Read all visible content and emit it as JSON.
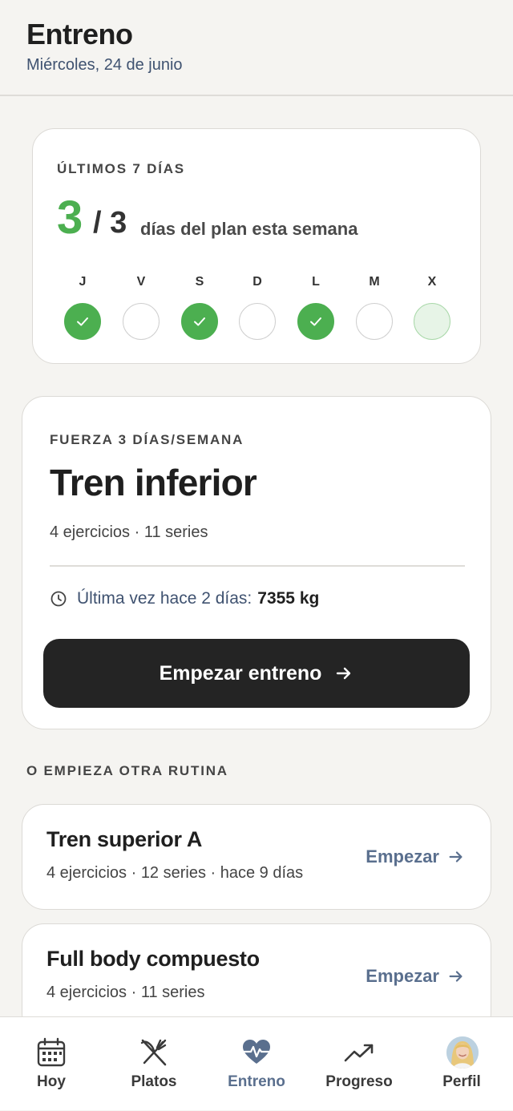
{
  "header": {
    "title": "Entreno",
    "date": "Miércoles, 24 de junio"
  },
  "week": {
    "label": "ÚLTIMOS 7 DÍAS",
    "done": "3",
    "total": "/ 3",
    "plan_text": "días del plan esta semana",
    "days": [
      {
        "letter": "J",
        "state": "done"
      },
      {
        "letter": "V",
        "state": "empty"
      },
      {
        "letter": "S",
        "state": "done"
      },
      {
        "letter": "D",
        "state": "empty"
      },
      {
        "letter": "L",
        "state": "done"
      },
      {
        "letter": "M",
        "state": "empty"
      },
      {
        "letter": "X",
        "state": "today"
      }
    ]
  },
  "featured": {
    "plan_label": "FUERZA 3 DÍAS/SEMANA",
    "routine": "Tren inferior",
    "meta": "4 ejercicios · 11 series",
    "last_text": "Última vez hace 2 días:",
    "last_kg": "7355 kg",
    "start_label": "Empezar entreno"
  },
  "other": {
    "label": "O EMPIEZA OTRA RUTINA",
    "routines": [
      {
        "name": "Tren superior A",
        "meta": "4 ejercicios · 12 series · hace 9 días",
        "action": "Empezar"
      },
      {
        "name": "Full body compuesto",
        "meta": "4 ejercicios · 11 series",
        "action": "Empezar"
      }
    ]
  },
  "nav": {
    "items": [
      {
        "label": "Hoy",
        "icon": "calendar-icon"
      },
      {
        "label": "Platos",
        "icon": "utensils-icon"
      },
      {
        "label": "Entreno",
        "icon": "heart-pulse-icon",
        "active": true
      },
      {
        "label": "Progreso",
        "icon": "trend-up-icon"
      },
      {
        "label": "Perfil",
        "icon": "avatar"
      }
    ]
  },
  "colors": {
    "accent_green": "#4caf50",
    "accent_blue": "#5a6f8e",
    "button_dark": "#242424",
    "background": "#f5f4f1"
  }
}
